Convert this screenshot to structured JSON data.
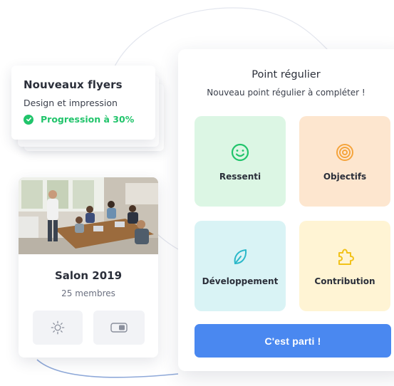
{
  "flyers_card": {
    "title": "Nouveaux flyers",
    "subtitle": "Design et impression",
    "progress": "Progression à 30%",
    "progress_value": 0.3,
    "check_icon": "check-circle-icon"
  },
  "team_card": {
    "name": "Salon 2019",
    "members": "25 membres",
    "photo": "team-meeting-photo",
    "buttons": [
      {
        "icon": "sun-icon"
      },
      {
        "icon": "toggle-icon"
      }
    ]
  },
  "checkin_panel": {
    "title": "Point régulier",
    "subtitle": "Nouveau point régulier à compléter !",
    "tiles": [
      {
        "label": "Ressenti",
        "icon": "smiley-icon",
        "color": "#dcf6e4",
        "icon_color": "#21c46b"
      },
      {
        "label": "Objectifs",
        "icon": "target-icon",
        "color": "#fde6cf",
        "icon_color": "#f5a43c"
      },
      {
        "label": "Développement",
        "icon": "leaf-icon",
        "color": "#d9f3f5",
        "icon_color": "#2bb8c9"
      },
      {
        "label": "Contribution",
        "icon": "puzzle-icon",
        "color": "#fff4d4",
        "icon_color": "#f2c21a"
      }
    ],
    "cta_label": "C'est parti !"
  },
  "colors": {
    "accent_blue": "#4a88f0",
    "success_green": "#21c46b"
  }
}
